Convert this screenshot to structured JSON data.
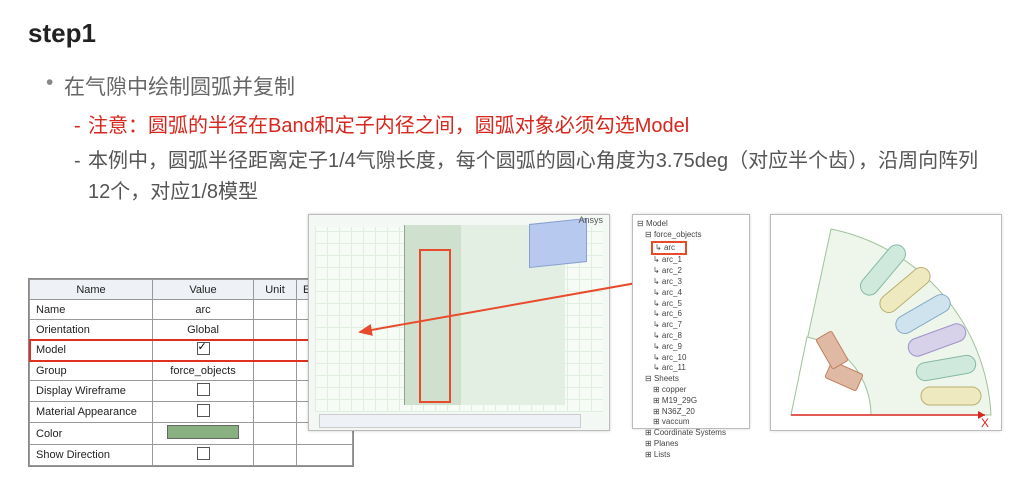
{
  "title": "step1",
  "bullet_main": "在气隙中绘制圆弧并复制",
  "bullet_warn": "注意：圆弧的半径在Band和定子内径之间，圆弧对象必须勾选Model",
  "bullet_detail": "本例中，圆弧半径距离定子1/4气隙长度，每个圆弧的圆心角度为3.75deg（对应半个齿），沿周向阵列12个，对应1/8模型",
  "props": {
    "headers": [
      "Name",
      "Value",
      "Unit",
      "Evalua..."
    ],
    "rows": [
      {
        "name": "Name",
        "value": "arc",
        "checkbox": false,
        "highlight": false
      },
      {
        "name": "Orientation",
        "value": "Global",
        "checkbox": false,
        "highlight": false
      },
      {
        "name": "Model",
        "value": "",
        "checkbox": true,
        "checked": true,
        "highlight": true
      },
      {
        "name": "Group",
        "value": "force_objects",
        "checkbox": false,
        "highlight": false
      },
      {
        "name": "Display Wireframe",
        "value": "",
        "checkbox": true,
        "checked": false,
        "highlight": false
      },
      {
        "name": "Material Appearance",
        "value": "",
        "checkbox": true,
        "checked": false,
        "highlight": false
      },
      {
        "name": "Color",
        "value": "",
        "swatch": true,
        "highlight": false
      },
      {
        "name": "Show Direction",
        "value": "",
        "checkbox": true,
        "checked": false,
        "highlight": false
      }
    ]
  },
  "shot_badge": "Ansys",
  "tree": {
    "root": "Model",
    "group": "force_objects",
    "selected": "arc",
    "arcs": [
      "arc_1",
      "arc_2",
      "arc_3",
      "arc_4",
      "arc_5",
      "arc_6",
      "arc_7",
      "arc_8",
      "arc_9",
      "arc_10",
      "arc_11"
    ],
    "sheets_header": "Sheets",
    "sheets": [
      "copper",
      "M19_29G",
      "N36Z_20",
      "vaccum"
    ],
    "extras": [
      "Coordinate Systems",
      "Planes",
      "Lists"
    ]
  },
  "axis_x": "X"
}
